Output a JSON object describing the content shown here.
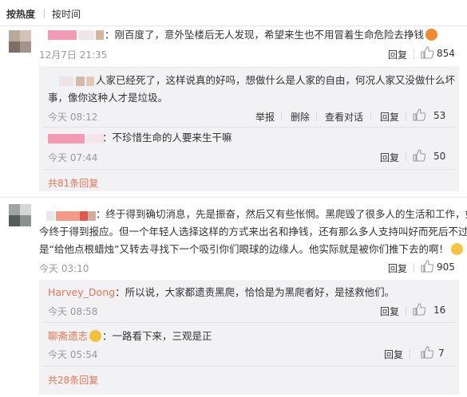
{
  "sort": {
    "hot": "按热度",
    "time": "按时间"
  },
  "actions": {
    "reply": "回复",
    "report": "举报",
    "delete": "删除",
    "view_thread": "查看对话"
  },
  "comments": [
    {
      "text": "：刚百度了，意外坠楼后无人发现，希望来生也不用冒着生命危险去挣钱",
      "time": "12月7日 21:35",
      "likes": "854",
      "replies": [
        {
          "line1": "人家已经死了，这样说真的好吗，想做什么是人家的自由，何况人家又没做什么坏",
          "line2": "事，像你这种人才是垃圾。",
          "time": "今天 08:12",
          "likes": "53"
        },
        {
          "line1": "：不珍惜生命的人要来生干嘛",
          "time": "今天 07:44",
          "likes": "50"
        }
      ],
      "more": "共81条回复"
    },
    {
      "line1": "：终于得到确切消息，先是振奋，然后又有些怅惘。黑爬毁了很多人的生活和工作，如",
      "line2": "今终于得到报应。但一个年轻人选择这样的方式来出名和挣钱，还有那么多人支持叫好而死后不过",
      "line3": "是“给他点根蜡烛”又转去寻找下一个吸引你们眼球的边缘人。他实际就是被你们推下去的啊！",
      "time": "今天 03:10",
      "likes": "905",
      "replies": [
        {
          "user": "Harvey_Dong",
          "text": "：所以说，大家都遗责黑爬，恰恰是为黑爬者好，是拯救他们。",
          "time": "今天 08:58",
          "likes": "16"
        },
        {
          "user": "聊斋遗志",
          "text": "：一路看下来，三观是正",
          "time": "今天 05:54",
          "likes": "7"
        }
      ],
      "more": "共28条回复"
    }
  ]
}
